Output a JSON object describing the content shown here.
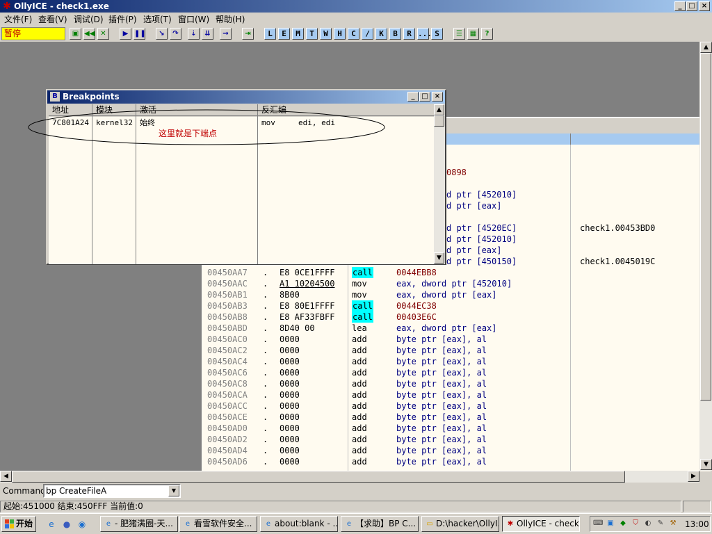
{
  "window": {
    "title": "OllyICE - check1.exe",
    "min_label": "_",
    "max_label": "□",
    "close_label": "×"
  },
  "menu": [
    "文件(F)",
    "查看(V)",
    "调试(D)",
    "插件(P)",
    "选项(T)",
    "窗口(W)",
    "帮助(H)"
  ],
  "toolbar": {
    "state_text": "暂停",
    "letter_buttons": [
      "L",
      "E",
      "M",
      "T",
      "W",
      "H",
      "C",
      "/",
      "K",
      "B",
      "R",
      "...",
      "S"
    ]
  },
  "breakpoints": {
    "title": "Breakpoints",
    "columns": [
      "地址",
      "模块",
      "激活",
      "反汇编"
    ],
    "rows": [
      {
        "address": "7C801A24",
        "module": "kernel32",
        "active": "始终",
        "disasm": "mov     edi, edi"
      }
    ],
    "note": "这里就是下端点"
  },
  "cpu": {
    "partial_lines": [
      {
        "op": "0898",
        "comment": ""
      },
      {
        "op": "d ptr [452010]",
        "comment": ""
      },
      {
        "op": "d ptr [eax]",
        "comment": ""
      },
      {
        "op": "d ptr [4520EC]",
        "comment": "check1.00453BD0"
      },
      {
        "op": "d ptr [452010]",
        "comment": ""
      },
      {
        "op": "d ptr [eax]",
        "comment": ""
      },
      {
        "op": "d ptr [450150]",
        "comment": "check1.0045019C"
      }
    ],
    "lines": [
      {
        "addr": "00450AA7",
        "dot": ".",
        "hex": "E8 0CE1FFFF",
        "mn": "call",
        "op": "0044EBB8"
      },
      {
        "addr": "00450AAC",
        "dot": ".",
        "hex": "A1 10204500",
        "mn": "mov",
        "op": "eax, dword ptr [452010]"
      },
      {
        "addr": "00450AB1",
        "dot": ".",
        "hex": "8B00",
        "mn": "mov",
        "op": "eax, dword ptr [eax]"
      },
      {
        "addr": "00450AB3",
        "dot": ".",
        "hex": "E8 80E1FFFF",
        "mn": "call",
        "op": "0044EC38"
      },
      {
        "addr": "00450AB8",
        "dot": ".",
        "hex": "E8 AF33FBFF",
        "mn": "call",
        "op": "00403E6C"
      },
      {
        "addr": "00450ABD",
        "dot": ".",
        "hex": "8D40 00",
        "mn": "lea",
        "op": "eax, dword ptr [eax]"
      },
      {
        "addr": "00450AC0",
        "dot": ".",
        "hex": "0000",
        "mn": "add",
        "op": "byte ptr [eax], al"
      },
      {
        "addr": "00450AC2",
        "dot": ".",
        "hex": "0000",
        "mn": "add",
        "op": "byte ptr [eax], al"
      },
      {
        "addr": "00450AC4",
        "dot": ".",
        "hex": "0000",
        "mn": "add",
        "op": "byte ptr [eax], al"
      },
      {
        "addr": "00450AC6",
        "dot": ".",
        "hex": "0000",
        "mn": "add",
        "op": "byte ptr [eax], al"
      },
      {
        "addr": "00450AC8",
        "dot": ".",
        "hex": "0000",
        "mn": "add",
        "op": "byte ptr [eax], al"
      },
      {
        "addr": "00450ACA",
        "dot": ".",
        "hex": "0000",
        "mn": "add",
        "op": "byte ptr [eax], al"
      },
      {
        "addr": "00450ACC",
        "dot": ".",
        "hex": "0000",
        "mn": "add",
        "op": "byte ptr [eax], al"
      },
      {
        "addr": "00450ACE",
        "dot": ".",
        "hex": "0000",
        "mn": "add",
        "op": "byte ptr [eax], al"
      },
      {
        "addr": "00450AD0",
        "dot": ".",
        "hex": "0000",
        "mn": "add",
        "op": "byte ptr [eax], al"
      },
      {
        "addr": "00450AD2",
        "dot": ".",
        "hex": "0000",
        "mn": "add",
        "op": "byte ptr [eax], al"
      },
      {
        "addr": "00450AD4",
        "dot": ".",
        "hex": "0000",
        "mn": "add",
        "op": "byte ptr [eax], al"
      },
      {
        "addr": "00450AD6",
        "dot": ".",
        "hex": "0000",
        "mn": "add",
        "op": "byte ptr [eax], al"
      }
    ]
  },
  "command": {
    "label": "Command",
    "value": "bp CreateFileA"
  },
  "status": {
    "text": "起始:451000 结束:450FFF 当前值:0"
  },
  "taskbar": {
    "start_label": "开始",
    "tasks": [
      "- 肥猪满圈-天...",
      "看雪软件安全...",
      "about:blank - ...",
      "【求助】BP C...",
      "D:\\hacker\\OllyI...",
      "OllyICE - check..."
    ],
    "clock": "13:00"
  },
  "colors": {
    "title_gradient_start": "#0a246a",
    "state_bg": "#ffff00",
    "call_highlight": "#00ffff",
    "annotation": "#c00000"
  }
}
